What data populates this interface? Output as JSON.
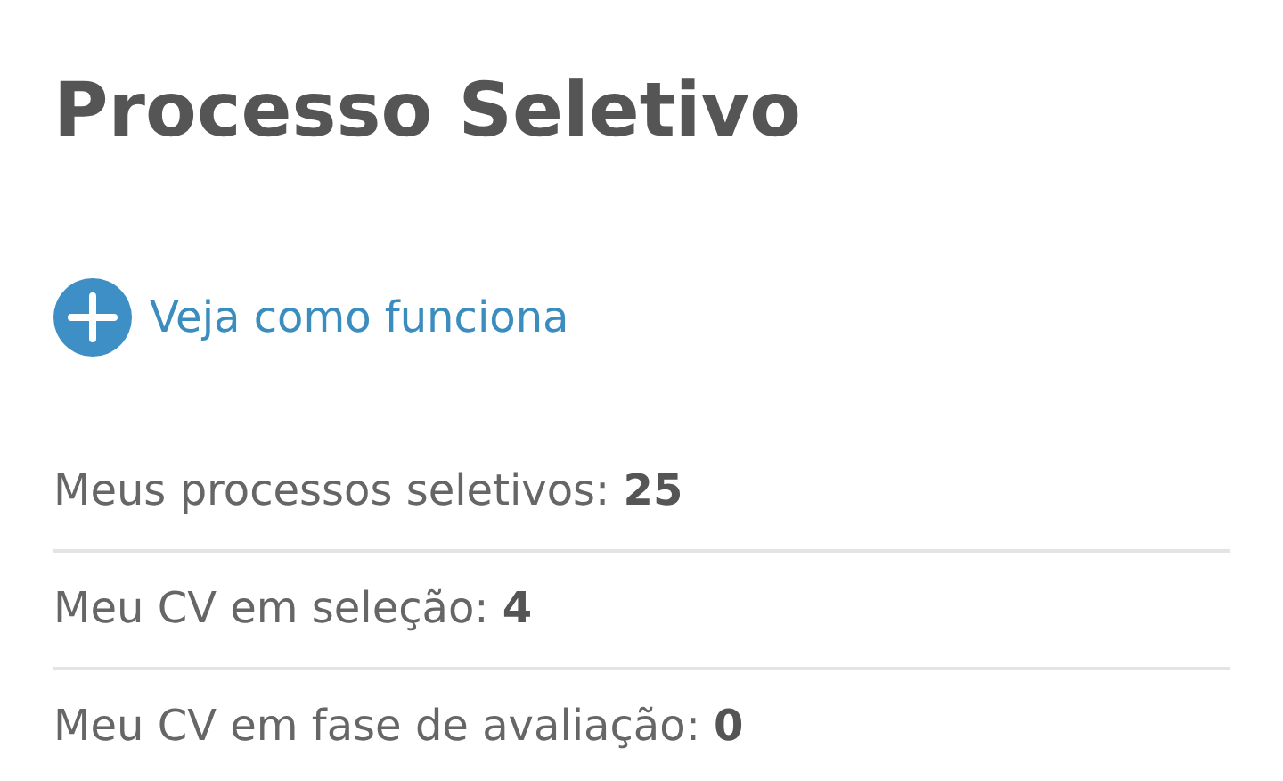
{
  "title": "Processo Seletivo",
  "link": {
    "label": "Veja como funciona"
  },
  "stats": [
    {
      "text": "Meus processos seletivos: **25**"
    },
    {
      "text": "Meu CV em seleção: **4**"
    },
    {
      "text": "Meu CV em fase de avaliação: **0**"
    }
  ]
}
